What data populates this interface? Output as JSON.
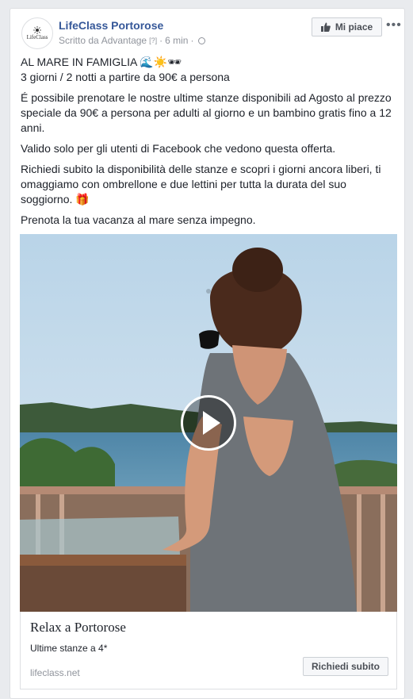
{
  "post": {
    "page_name": "LifeClass Portorose",
    "avatar_text": "LifeClass",
    "written_by": "Scritto da",
    "author": "Advantage",
    "help_mark": "[?]",
    "separator": "·",
    "time": "6 min",
    "separator2": "·",
    "like_label": "Mi piace",
    "more_label": "•••"
  },
  "body": {
    "line1": "AL MARE IN FAMIGLIA 🌊☀️🕶",
    "line2": "3 giorni / 2 notti a partire da 90€ a persona",
    "para2": "É possibile prenotare le nostre ultime stanze disponibili ad Agosto al prezzo speciale da 90€ a persona per adulti al giorno e un bambino gratis fino a 12 anni.",
    "para3": "Valido solo per gli utenti di Facebook che vedono questa offerta.",
    "para4": "Richiedi subito la disponibilità delle stanze e scopri i giorni ancora liberi, ti omaggiamo con ombrellone e due lettini per tutta la durata del suo soggiorno. 🎁",
    "para5": "Prenota la tua vacanza al mare senza impegno."
  },
  "link": {
    "title": "Relax a Portorose",
    "description": "Ultime stanze a 4*",
    "domain": "lifeclass.net",
    "cta": "Richiedi subito"
  },
  "colors": {
    "link_blue": "#365899",
    "meta_gray": "#90949c",
    "page_bg": "#e9ebee"
  }
}
